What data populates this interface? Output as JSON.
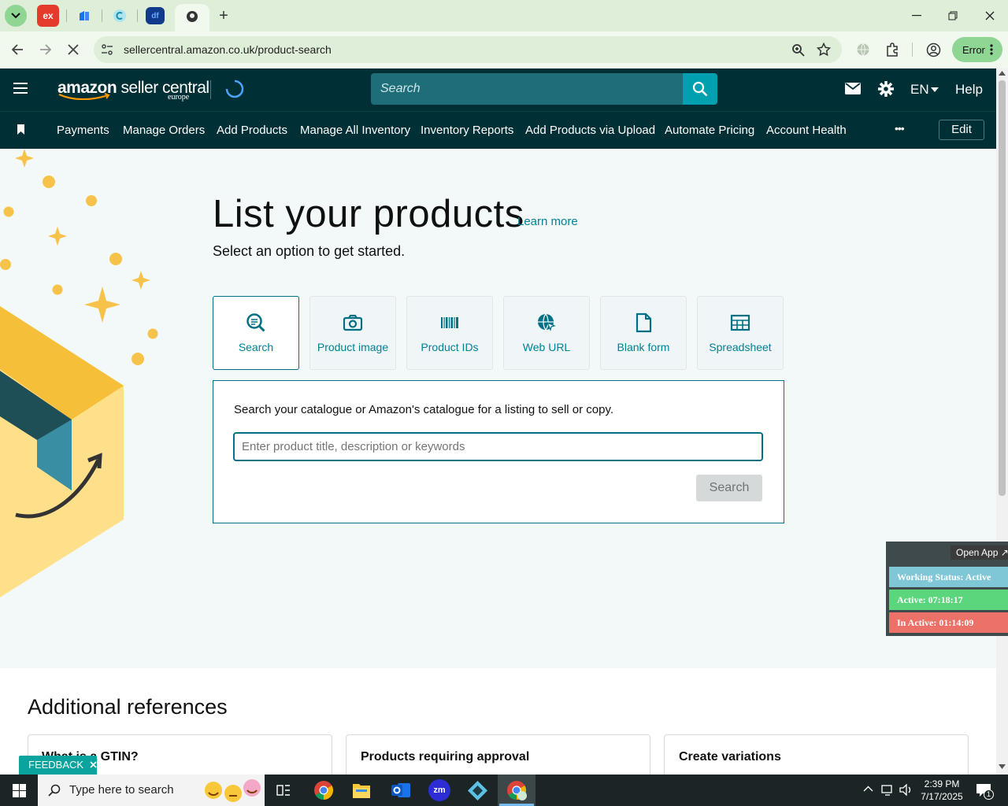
{
  "browser": {
    "tabs": [
      "ex",
      "tab-2",
      "tab-3",
      "df",
      "active-tab"
    ],
    "url": "sellercentral.amazon.co.uk/product-search",
    "profile_status": "Error",
    "new_tab_symbol": "+"
  },
  "header": {
    "logo_main": "amazon",
    "logo_rest": " seller central",
    "logo_sub": "europe",
    "search_placeholder": "Search",
    "language": "EN",
    "help": "Help"
  },
  "nav": {
    "items": [
      "Payments",
      "Manage Orders",
      "Add Products",
      "Manage All Inventory",
      "Inventory Reports",
      "Add Products via Upload",
      "Automate Pricing",
      "Account Health"
    ],
    "more": "•••",
    "edit": "Edit"
  },
  "main": {
    "title": "List your products",
    "learn_more": "Learn more",
    "subtitle": "Select an option to get started.",
    "options": [
      "Search",
      "Product image",
      "Product IDs",
      "Web URL",
      "Blank form",
      "Spreadsheet"
    ],
    "panel_text": "Search your catalogue or Amazon's catalogue for a listing to sell or copy.",
    "input_placeholder": "Enter product title, description or keywords",
    "search_button": "Search"
  },
  "references": {
    "heading": "Additional references",
    "cards": [
      "What is a GTIN?",
      "Products requiring approval",
      "Create variations"
    ]
  },
  "feedback": "FEEDBACK",
  "widget": {
    "open_app": "Open App ↗",
    "working_status": "Working Status: Active",
    "active": "Active: 07:18:17",
    "inactive": "In Active: 01:14:09",
    "colors": {
      "status": "#7fc6d6",
      "active": "#5cd67d",
      "inactive": "#ec7168"
    }
  },
  "taskbar": {
    "search_placeholder": "Type here to search",
    "time": "2:39 PM",
    "date": "7/17/2025",
    "notifications": "1",
    "apps": [
      "task-view",
      "chrome",
      "file-explorer",
      "outlook",
      "zoom",
      "app-diamond",
      "chrome-profile"
    ]
  },
  "colors": {
    "header": "#002f36",
    "accent": "#008296",
    "page_bg": "#f3f8f9"
  }
}
